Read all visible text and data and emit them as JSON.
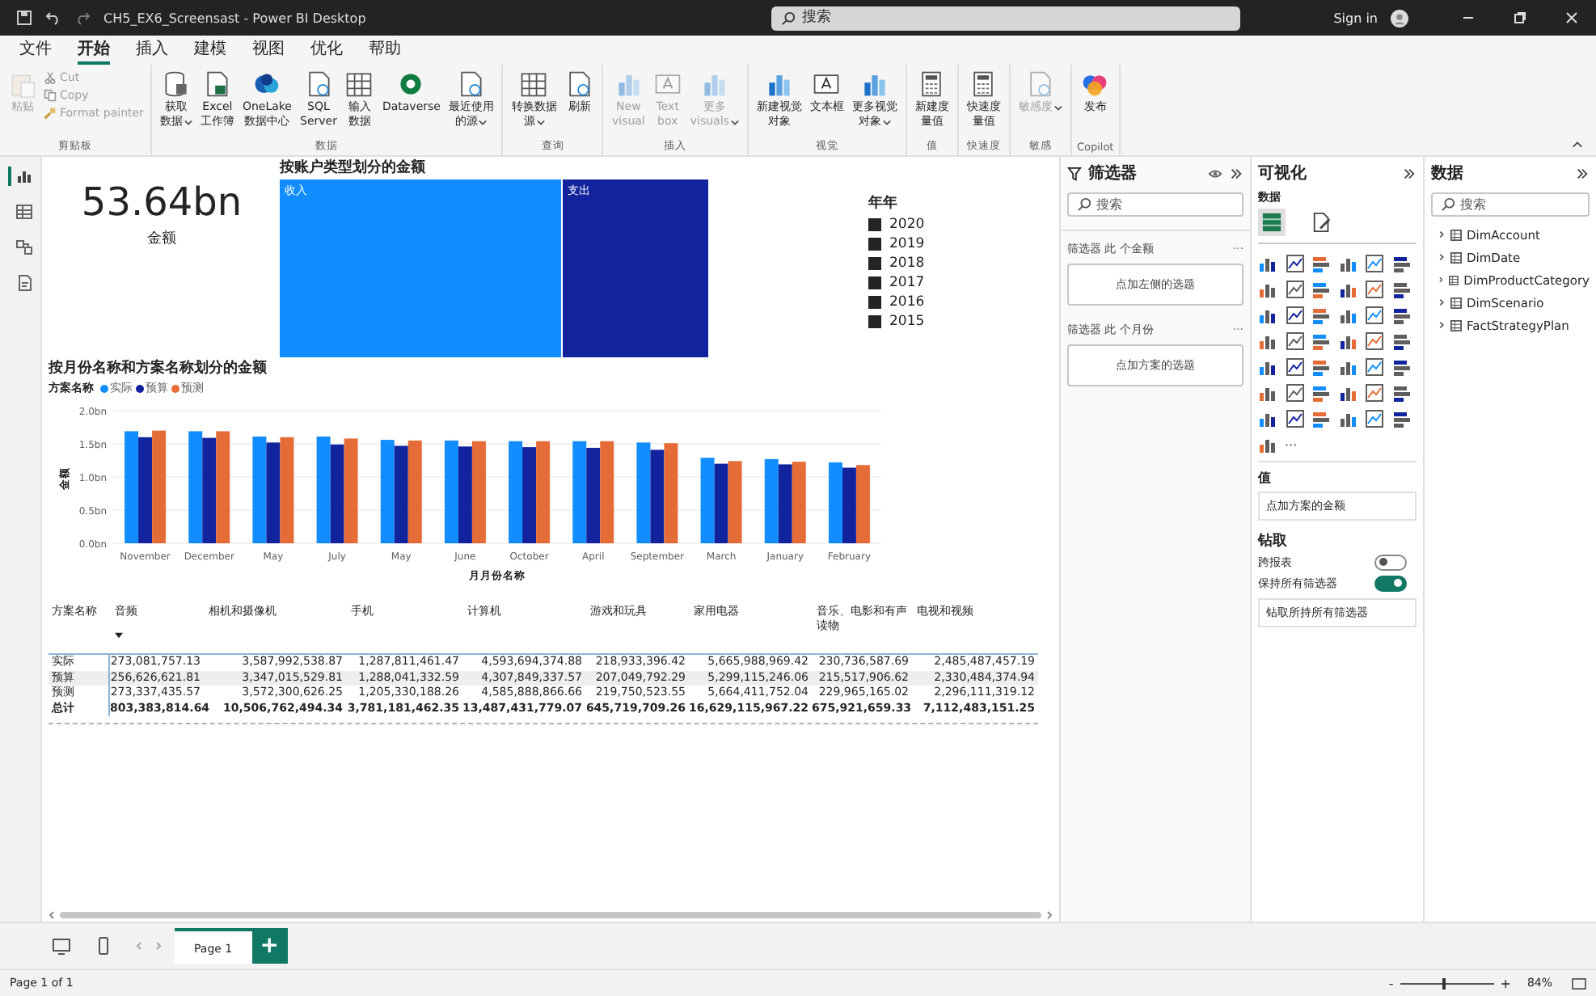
{
  "title_bar": {
    "title": "CH5_EX6_Screensast - Power BI Desktop",
    "search": {
      "placeholder": "搜索"
    },
    "sign_in": "Sign in"
  },
  "menu_tabs": [
    {
      "label": "文件",
      "selected": false
    },
    {
      "label": "开始",
      "selected": true
    },
    {
      "label": "插入",
      "selected": false
    },
    {
      "label": "建模",
      "selected": false
    },
    {
      "label": "视图",
      "selected": false
    },
    {
      "label": "优化",
      "selected": false
    },
    {
      "label": "帮助",
      "selected": false
    }
  ],
  "ribbon_groups": [
    {
      "label": "剪贴板",
      "buttons": [
        {
          "kind": "large",
          "lines": [
            "粘贴"
          ],
          "disabled": true
        },
        {
          "kind": "small",
          "lines": [
            "Cut"
          ],
          "disabled": true
        },
        {
          "kind": "small",
          "lines": [
            "Copy"
          ],
          "disabled": true
        },
        {
          "kind": "small",
          "lines": [
            "Format painter"
          ],
          "disabled": true
        }
      ]
    },
    {
      "label": "数据",
      "buttons": [
        {
          "kind": "large",
          "lines": [
            "获取",
            "数据"
          ],
          "disabled": false,
          "dropdown": true
        },
        {
          "kind": "large",
          "lines": [
            "Excel",
            "工作簿"
          ],
          "disabled": false
        },
        {
          "kind": "large",
          "lines": [
            "OneLake",
            "数据中心"
          ],
          "disabled": false
        },
        {
          "kind": "large",
          "lines": [
            "SQL",
            "Server"
          ],
          "disabled": false
        },
        {
          "kind": "large",
          "lines": [
            "输入",
            "数据"
          ],
          "disabled": false
        },
        {
          "kind": "large",
          "lines": [
            "Dataverse"
          ],
          "disabled": false
        },
        {
          "kind": "large",
          "lines": [
            "最近使用",
            "的源"
          ],
          "disabled": false,
          "dropdown": true
        }
      ]
    },
    {
      "label": "查询",
      "buttons": [
        {
          "kind": "large",
          "lines": [
            "转换数据",
            "源"
          ],
          "disabled": false,
          "dropdown": true
        },
        {
          "kind": "large",
          "lines": [
            "刷新"
          ],
          "disabled": false
        }
      ]
    },
    {
      "label": "插入",
      "buttons": [
        {
          "kind": "large",
          "lines": [
            "New",
            "visual"
          ],
          "disabled": true
        },
        {
          "kind": "large",
          "lines": [
            "Text",
            "box"
          ],
          "disabled": true
        },
        {
          "kind": "large",
          "lines": [
            "更多",
            "visuals"
          ],
          "disabled": true,
          "dropdown": true
        }
      ]
    },
    {
      "label": "视觉",
      "buttons": [
        {
          "kind": "large",
          "lines": [
            "新建视觉",
            "对象"
          ],
          "disabled": false
        },
        {
          "kind": "large",
          "lines": [
            "文本框"
          ],
          "disabled": false
        },
        {
          "kind": "large",
          "lines": [
            "更多视觉",
            "对象"
          ],
          "disabled": false,
          "dropdown": true
        }
      ]
    },
    {
      "label": "值",
      "buttons": [
        {
          "kind": "large",
          "lines": [
            "新建度",
            "量值"
          ],
          "disabled": false
        }
      ]
    },
    {
      "label": "快速度",
      "buttons": [
        {
          "kind": "large",
          "lines": [
            "快速度",
            "量值"
          ],
          "disabled": false
        }
      ]
    },
    {
      "label": "敏感",
      "buttons": [
        {
          "kind": "large",
          "lines": [
            "敏感度"
          ],
          "disabled": true,
          "dropdown": true
        }
      ]
    },
    {
      "label": "Copilot",
      "buttons": [
        {
          "kind": "large",
          "lines": [
            "发布"
          ],
          "disabled": false
        }
      ]
    }
  ],
  "view_rail": [
    {
      "selected": true
    },
    {
      "selected": false
    },
    {
      "selected": false
    },
    {
      "selected": false
    }
  ],
  "card": {
    "value": "53.64bn",
    "label": "金额"
  },
  "treemap": {
    "title": "按账户类型划分的金额",
    "tiles": [
      {
        "label": "收入",
        "color": "#118dff"
      },
      {
        "label": "支出",
        "color": "#12239e"
      }
    ]
  },
  "year_legend": {
    "title": "年年",
    "items": [
      "2020",
      "2019",
      "2018",
      "2017",
      "2016",
      "2015"
    ]
  },
  "bar_chart": {
    "legend_title": "方案名称",
    "chart_data": {
      "type": "bar",
      "title": "按月份名称和方案名称划分的金额",
      "xlabel": "月月份名称",
      "ylabel": "金额",
      "categories": [
        "November",
        "December",
        "May",
        "July",
        "May",
        "June",
        "October",
        "April",
        "September",
        "March",
        "January",
        "February"
      ],
      "series": [
        {
          "name": "实际",
          "color": "#118dff",
          "values": [
            1.69,
            1.69,
            1.61,
            1.61,
            1.56,
            1.55,
            1.54,
            1.54,
            1.52,
            1.29,
            1.27,
            1.22
          ]
        },
        {
          "name": "预算",
          "color": "#12239e",
          "values": [
            1.6,
            1.59,
            1.52,
            1.49,
            1.47,
            1.46,
            1.45,
            1.44,
            1.41,
            1.2,
            1.19,
            1.14
          ]
        },
        {
          "name": "预测",
          "color": "#e66c37",
          "values": [
            1.7,
            1.69,
            1.6,
            1.58,
            1.55,
            1.54,
            1.54,
            1.54,
            1.51,
            1.24,
            1.23,
            1.18
          ]
        }
      ],
      "grid": true,
      "ylim": [
        0,
        2
      ],
      "yticks": [
        {
          "value": 0,
          "label": "0.0bn"
        },
        {
          "value": 0.5,
          "label": "0.5bn"
        },
        {
          "value": 1,
          "label": "1.0bn"
        },
        {
          "value": 1.5,
          "label": "1.5bn"
        },
        {
          "value": 2,
          "label": "2.0bn"
        }
      ]
    }
  },
  "matrix": {
    "header": "方案名称",
    "columns": [
      "音频",
      "相机和摄像机",
      "手机",
      "计算机",
      "游戏和玩具",
      "家用电器",
      "音乐、电影和有声读物",
      "电视和视频"
    ],
    "rows": [
      {
        "kind": "data",
        "label": "实际",
        "cells": [
          "273,081,757.13",
          "3,587,992,538.87",
          "1,287,811,461.47",
          "4,593,694,374.88",
          "218,933,396.42",
          "5,665,988,969.42",
          "230,736,587.69",
          "2,485,487,457.19"
        ]
      },
      {
        "kind": "data",
        "label": "预算",
        "cells": [
          "256,626,621.81",
          "3,347,015,529.81",
          "1,288,041,332.59",
          "4,307,849,337.57",
          "207,049,792.29",
          "5,299,115,246.06",
          "215,517,906.62",
          "2,330,484,374.94"
        ]
      },
      {
        "kind": "data",
        "label": "预测",
        "cells": [
          "273,337,435.57",
          "3,572,300,626.25",
          "1,205,330,188.26",
          "4,585,888,866.66",
          "219,750,523.55",
          "5,664,411,752.04",
          "229,965,165.02",
          "2,296,111,319.12"
        ]
      },
      {
        "kind": "total",
        "label": "总计",
        "cells": [
          "803,383,814.64",
          "10,506,762,494.34",
          "3,781,181,462.35",
          "13,487,431,779.07",
          "645,719,709.26",
          "16,629,115,967.22",
          "675,921,659.33",
          "7,112,483,151.25"
        ]
      }
    ]
  },
  "filters_pane": {
    "title": "筛选器",
    "search": {
      "placeholder": "搜索"
    },
    "sections": [
      {
        "label": "筛选器 此 个金额",
        "more": "···",
        "drop": "点加左侧的选题"
      },
      {
        "label": "筛选器 此 个月份",
        "more": "···",
        "drop": "点加方案的选题"
      }
    ]
  },
  "viz_pane": {
    "title": "可视化",
    "build_label": "数据",
    "tabs": [
      {
        "selected": true
      },
      {
        "selected": false
      }
    ],
    "more": "···",
    "values_label": "值",
    "values_field": "点加方案的金额",
    "drill_title": "钻取",
    "toggles": [
      {
        "label": "跨报表",
        "on": false
      },
      {
        "label": "保持所有筛选器",
        "on": true
      }
    ],
    "drill_button": "钻取所持所有筛选器"
  },
  "data_pane": {
    "title": "数据",
    "search": {
      "placeholder": "搜索"
    },
    "tables": [
      {
        "name": "DimAccount",
        "expanded": false
      },
      {
        "name": "DimDate",
        "expanded": false
      },
      {
        "name": "DimProductCategory",
        "expanded": false
      },
      {
        "name": "DimScenario",
        "expanded": false
      },
      {
        "name": "FactStrategyPlan",
        "expanded": false
      }
    ]
  },
  "page_tabs": [
    {
      "label": "Page 1",
      "selected": true
    }
  ],
  "add_page": "+",
  "status_bar": {
    "text": "Page 1 of 1",
    "zoom_out": "-",
    "zoom_in": "+",
    "zoom": {
      "level": 0.45
    },
    "zoom_reading": "84%"
  }
}
